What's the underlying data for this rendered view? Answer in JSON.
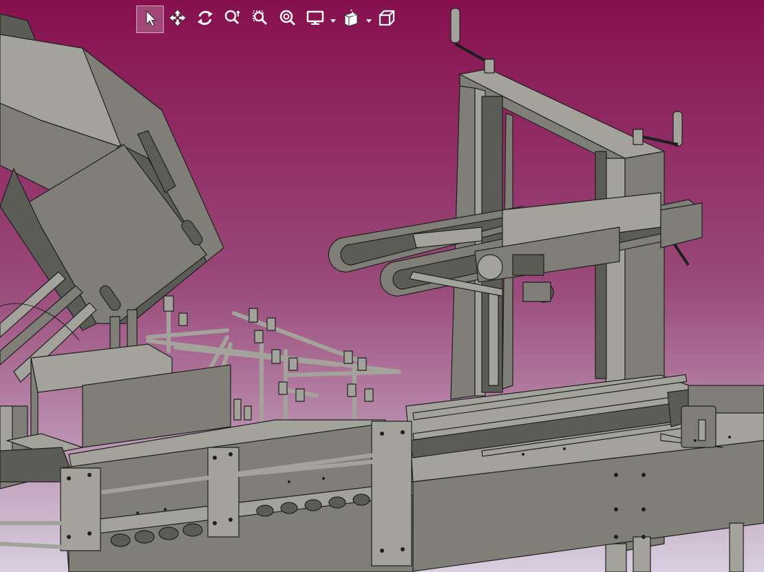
{
  "app": {
    "theme": {
      "top_bar": "#5a4a5a",
      "bg_top": "#86104e",
      "bg_mid": "#9a4a7a",
      "bg_bottom": "#d8cfe0",
      "model_fill": "#7f7f78",
      "model_light": "#a3a39b",
      "model_dark": "#5c5c56",
      "edge": "#1e1e1e",
      "icon_color": "#ffffff"
    }
  },
  "toolbar": {
    "tools": [
      {
        "id": "select",
        "icon": "cursor-arrow-icon",
        "active": true
      },
      {
        "id": "pan",
        "icon": "move-arrows-icon",
        "active": false
      },
      {
        "id": "rotate",
        "icon": "rotate-icon",
        "active": false
      },
      {
        "id": "zoom-dynamic",
        "icon": "zoom-dynamic-icon",
        "active": false
      },
      {
        "id": "zoom-window",
        "icon": "zoom-window-icon",
        "active": false
      },
      {
        "id": "zoom-fit",
        "icon": "zoom-fit-icon",
        "active": false
      },
      {
        "id": "display",
        "icon": "monitor-icon",
        "active": false,
        "has_dropdown": true
      },
      {
        "id": "section",
        "icon": "section-view-icon",
        "active": false,
        "has_dropdown": true
      },
      {
        "id": "view-cube",
        "icon": "view-cube-icon",
        "active": false
      }
    ]
  }
}
